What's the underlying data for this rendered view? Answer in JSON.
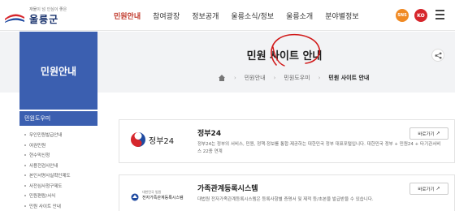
{
  "header": {
    "logo_sub": "재물이 넘 인심이 좋은",
    "logo_name": "울릉군",
    "nav": [
      {
        "label": "민원안내",
        "active": true
      },
      {
        "label": "참여광장"
      },
      {
        "label": "정보공개"
      },
      {
        "label": "울릉소식/정보"
      },
      {
        "label": "울릉소개"
      },
      {
        "label": "분야별정보"
      }
    ],
    "sns_label": "SNS",
    "lang_label": "KO"
  },
  "sidebar": {
    "title": "민원안내",
    "menu_head": "민원도우미",
    "items": [
      "무인민원발급안내",
      "여권민원",
      "현수막신청",
      "사용전검사안내",
      "본인서명사실확인제도",
      "사전심사청구제도",
      "민원편람/서식",
      "민원 사이트 안내"
    ]
  },
  "page": {
    "title": "민원 사이트 안내",
    "breadcrumb": [
      "민원안내",
      "민원도우미",
      "민원 사이트 안내"
    ]
  },
  "cards": [
    {
      "logo_text": "정부24",
      "title": "정부24",
      "desc": "정부24는 정부의 서비스, 민원, 정책·정보를 통합·제공하는 대한민국 정부 대표포털입니다. 대한민국 정부 + 민원24 + 타기관서비스 22종 연계",
      "button": "바로가기"
    },
    {
      "logo_text": "전자가족관계등록시스템",
      "logo_sub": "대한민국 법원",
      "title": "가족관계등록시스템",
      "desc": "대법원 전자가족관계등록시스템은 등록사항별 증명서 및 제적 등/초본을 발급받을 수 있습니다.",
      "button": "바로가기"
    }
  ],
  "colors": {
    "accent_blue": "#3b5fb0",
    "active_red": "#c0392b",
    "sns_orange": "#f08a24",
    "ko_red": "#d6262c"
  }
}
